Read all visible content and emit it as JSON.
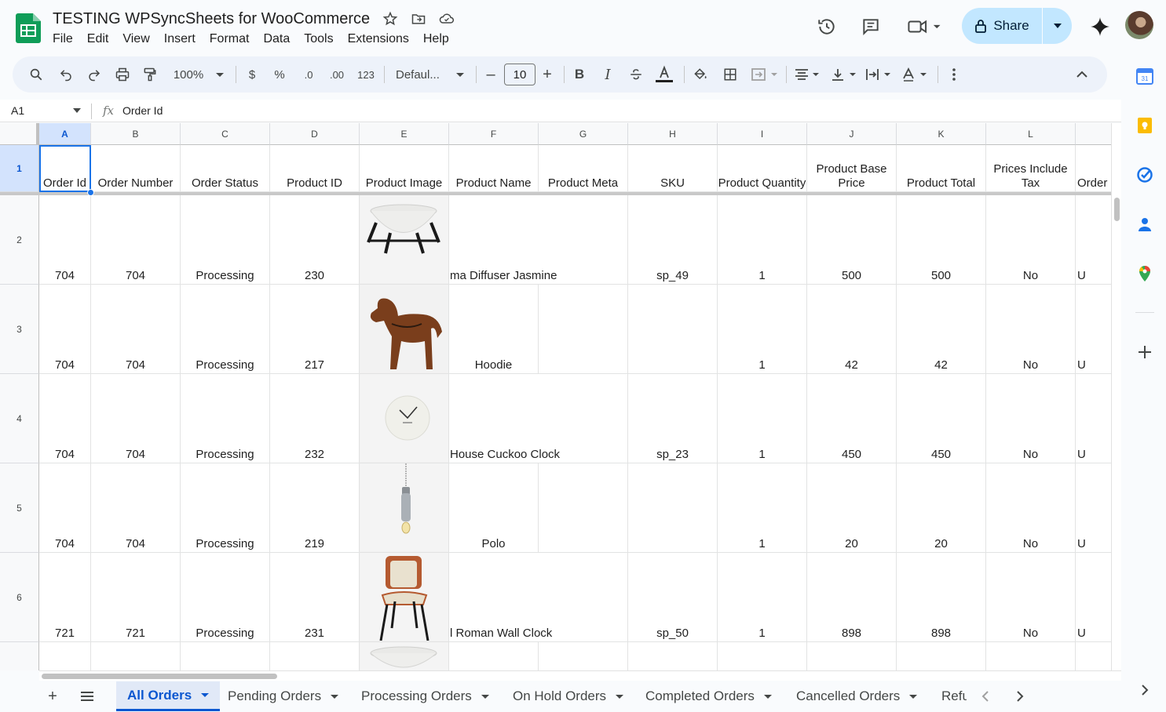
{
  "document": {
    "title": "TESTING WPSyncSheets for WooCommerce"
  },
  "menu": [
    "File",
    "Edit",
    "View",
    "Insert",
    "Format",
    "Data",
    "Tools",
    "Extensions",
    "Help"
  ],
  "share": {
    "label": "Share"
  },
  "toolbar": {
    "zoom": "100%",
    "currency": "$",
    "percent": "%",
    "decrease_decimal": ".0",
    "increase_decimal": ".00",
    "more_formats": "123",
    "font": "Defaul...",
    "font_size": "10",
    "bold": "B",
    "italic": "I"
  },
  "formula_bar": {
    "cell_ref": "A1",
    "fx": "fx",
    "value": "Order Id"
  },
  "grid": {
    "columns": [
      "A",
      "B",
      "C",
      "D",
      "E",
      "F",
      "G",
      "H",
      "I",
      "J",
      "K",
      "L",
      ""
    ],
    "headers": [
      "Order Id",
      "Order Number",
      "Order Status",
      "Product ID",
      "Product Image",
      "Product Name",
      "Product Meta",
      "SKU",
      "Product Quantity",
      "Product Base Price",
      "Product Total",
      "Prices Include Tax",
      "Order"
    ],
    "rows": [
      {
        "num": "2",
        "cells": [
          "704",
          "704",
          "Processing",
          "230",
          "",
          "ma Diffuser Jasmine",
          "",
          "sp_49",
          "1",
          "500",
          "500",
          "No",
          "U"
        ],
        "image": "bowl"
      },
      {
        "num": "3",
        "cells": [
          "704",
          "704",
          "Processing",
          "217",
          "",
          "Hoodie",
          "",
          "",
          "1",
          "42",
          "42",
          "No",
          "U"
        ],
        "image": "horse"
      },
      {
        "num": "4",
        "cells": [
          "704",
          "704",
          "Processing",
          "232",
          "",
          "House Cuckoo Clock",
          "",
          "sp_23",
          "1",
          "450",
          "450",
          "No",
          "U"
        ],
        "image": "clock"
      },
      {
        "num": "5",
        "cells": [
          "704",
          "704",
          "Processing",
          "219",
          "",
          "Polo",
          "",
          "",
          "1",
          "20",
          "20",
          "No",
          "U"
        ],
        "image": "lamp"
      },
      {
        "num": "6",
        "cells": [
          "721",
          "721",
          "Processing",
          "231",
          "",
          "l Roman Wall Clock",
          "",
          "sp_50",
          "1",
          "898",
          "898",
          "No",
          "U"
        ],
        "image": "chair"
      }
    ]
  },
  "sheet_tabs": [
    "All Orders",
    "Pending Orders",
    "Processing Orders",
    "On Hold Orders",
    "Completed Orders",
    "Cancelled Orders",
    "Refu"
  ],
  "side_panel": [
    "calendar-icon",
    "keep-icon",
    "tasks-icon",
    "contacts-icon",
    "maps-icon",
    "add-icon"
  ],
  "colors": {
    "accent": "#0b57d0",
    "share_bg": "#c2e7ff",
    "sheets_green": "#0f9d58",
    "selection_bg": "#d3e3fd"
  }
}
